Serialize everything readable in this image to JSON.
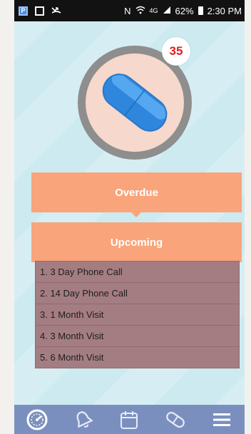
{
  "statusbar": {
    "left_icons": [
      "parking-icon",
      "screen-icon",
      "missed-call-icon"
    ],
    "network_label": "N",
    "signal_label": "4G",
    "battery": "62%",
    "time": "2:30 PM"
  },
  "pill": {
    "icon": "capsule-icon",
    "count": "35",
    "colors": {
      "capsule": "#3a8fe0",
      "ring": "#8e8e8e",
      "disc": "#f6d8cc",
      "badge_text": "#e01e1e"
    }
  },
  "sections": {
    "overdue_label": "Overdue",
    "upcoming_label": "Upcoming"
  },
  "upcoming_items": [
    "1. 3 Day Phone Call",
    "2. 14 Day Phone Call",
    "3. 1 Month Visit",
    "4. 3 Month Visit",
    "5. 6 Month Visit"
  ],
  "navbar": {
    "items": [
      "dashboard-icon",
      "bell-icon",
      "calendar-icon",
      "pill-icon",
      "menu-icon"
    ],
    "active": "dashboard-icon"
  },
  "colors": {
    "background": "#cdeaf0",
    "accent": "#f9a47a",
    "list_bg": "#a47d82",
    "nav_bg": "#7b8fbf"
  }
}
